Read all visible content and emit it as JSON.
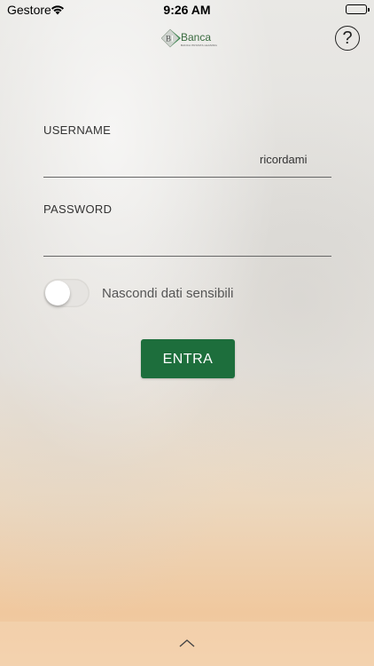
{
  "status_bar": {
    "carrier": "Gestore",
    "time": "9:26 AM",
    "wifi_icon": "wifi-icon",
    "battery_icon": "battery-icon",
    "battery_level": 1.0
  },
  "header": {
    "logo_icon": "bank-logo-icon",
    "logo_brand": "Banca",
    "logo_tagline": "BANCA PRIVATA LEASING",
    "help_symbol": "?",
    "help_icon": "help-icon"
  },
  "form": {
    "username_label": "USERNAME",
    "username_value": "",
    "remember_label": "ricordami",
    "password_label": "PASSWORD",
    "password_value": "",
    "hide_data_label": "Nascondi dati sensibili",
    "hide_data_on": false,
    "submit_label": "ENTRA"
  },
  "footer": {
    "chevron_icon": "chevron-up-icon"
  },
  "colors": {
    "primary": "#1d6e3c",
    "brand": "#3a6b3f",
    "text": "#333333"
  }
}
